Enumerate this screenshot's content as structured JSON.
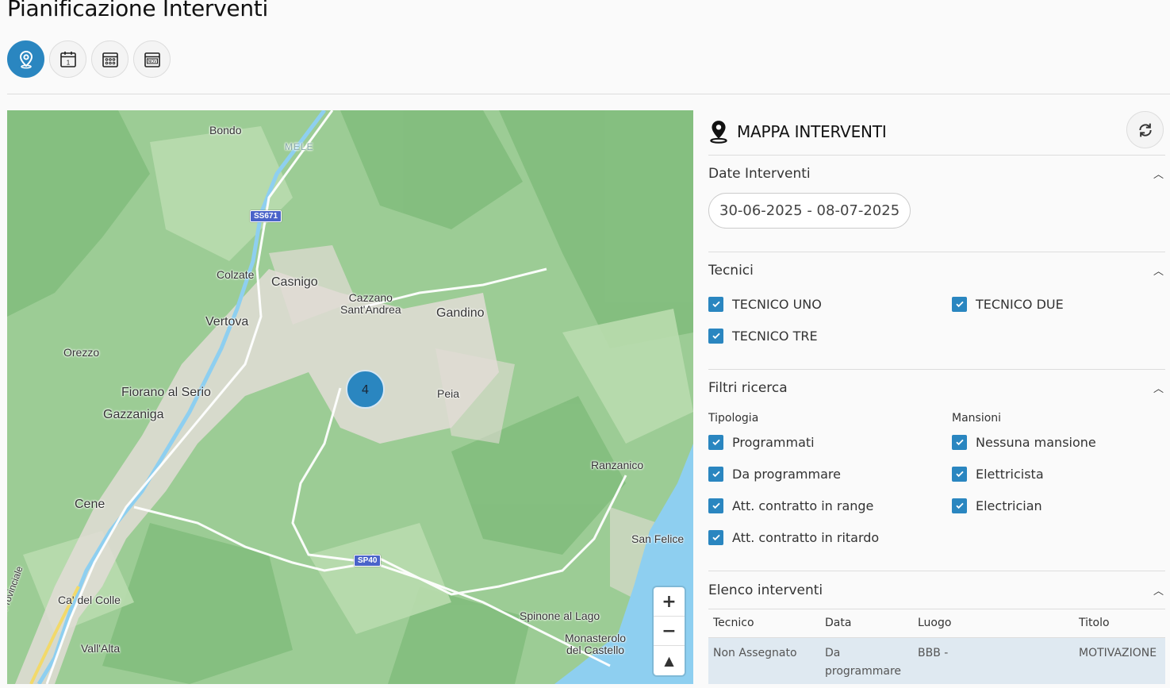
{
  "page": {
    "title": "Pianificazione Interventi"
  },
  "view_switch": {
    "buttons": [
      {
        "icon": "map-pin-icon",
        "active": true
      },
      {
        "icon": "calendar-day-icon",
        "active": false
      },
      {
        "icon": "calendar-month-icon",
        "active": false
      },
      {
        "icon": "calendar-year-icon",
        "active": false
      }
    ],
    "year_icon_text": "NOV",
    "day_icon_text": "1"
  },
  "map": {
    "places": {
      "bondo": "Bondo",
      "mele": "MELE",
      "colzate": "Colzate",
      "casnigo": "Casnigo",
      "cazzano": "Cazzano\nSant'Andrea",
      "gandino": "Gandino",
      "vertova": "Vertova",
      "orezzo": "Orezzo",
      "fiorano": "Fiorano al Serio",
      "gazzaniga": "Gazzaniga",
      "peia": "Peia",
      "ranzanico": "Ranzanico",
      "cene": "Cene",
      "san_felice": "San Felice",
      "ca_del_colle": "Ca' del Colle",
      "spinone": "Spinone al Lago",
      "monasterolo": "Monasterolo\ndel Castello",
      "vall_alta": "Vall'Alta",
      "provinciale": "ia Provinciale"
    },
    "road_shields": {
      "ss671": "SS671",
      "sp40": "SP40"
    },
    "cluster_count": "4",
    "zoom_in": "+",
    "zoom_out": "−",
    "reset_north": "▲"
  },
  "panel": {
    "title": "MAPPA INTERVENTI",
    "date_section": {
      "title": "Date Interventi",
      "range": "30-06-2025 - 08-07-2025"
    },
    "tecnici_section": {
      "title": "Tecnici",
      "items": [
        {
          "label": "TECNICO UNO",
          "checked": true
        },
        {
          "label": "TECNICO DUE",
          "checked": true
        },
        {
          "label": "TECNICO TRE",
          "checked": true
        }
      ]
    },
    "filtri_section": {
      "title": "Filtri ricerca",
      "tipologia": {
        "title": "Tipologia",
        "items": [
          {
            "label": "Programmati",
            "checked": true
          },
          {
            "label": "Da programmare",
            "checked": true
          },
          {
            "label": "Att. contratto in range",
            "checked": true
          },
          {
            "label": "Att. contratto in ritardo",
            "checked": true
          }
        ]
      },
      "mansioni": {
        "title": "Mansioni",
        "items": [
          {
            "label": "Nessuna mansione",
            "checked": true
          },
          {
            "label": "Elettricista",
            "checked": true
          },
          {
            "label": "Electrician",
            "checked": true
          }
        ]
      }
    },
    "elenco_section": {
      "title": "Elenco interventi",
      "columns": [
        "Tecnico",
        "Data",
        "Luogo",
        "Titolo"
      ],
      "rows": [
        {
          "tecnico": "Non Assegnato",
          "data": "Da programmare",
          "luogo": "BBB -",
          "titolo": "MOTIVAZIONE"
        }
      ]
    }
  },
  "colors": {
    "accent": "#2a86c0",
    "map_green": "#8fc48a",
    "lake": "#8ecff0"
  }
}
